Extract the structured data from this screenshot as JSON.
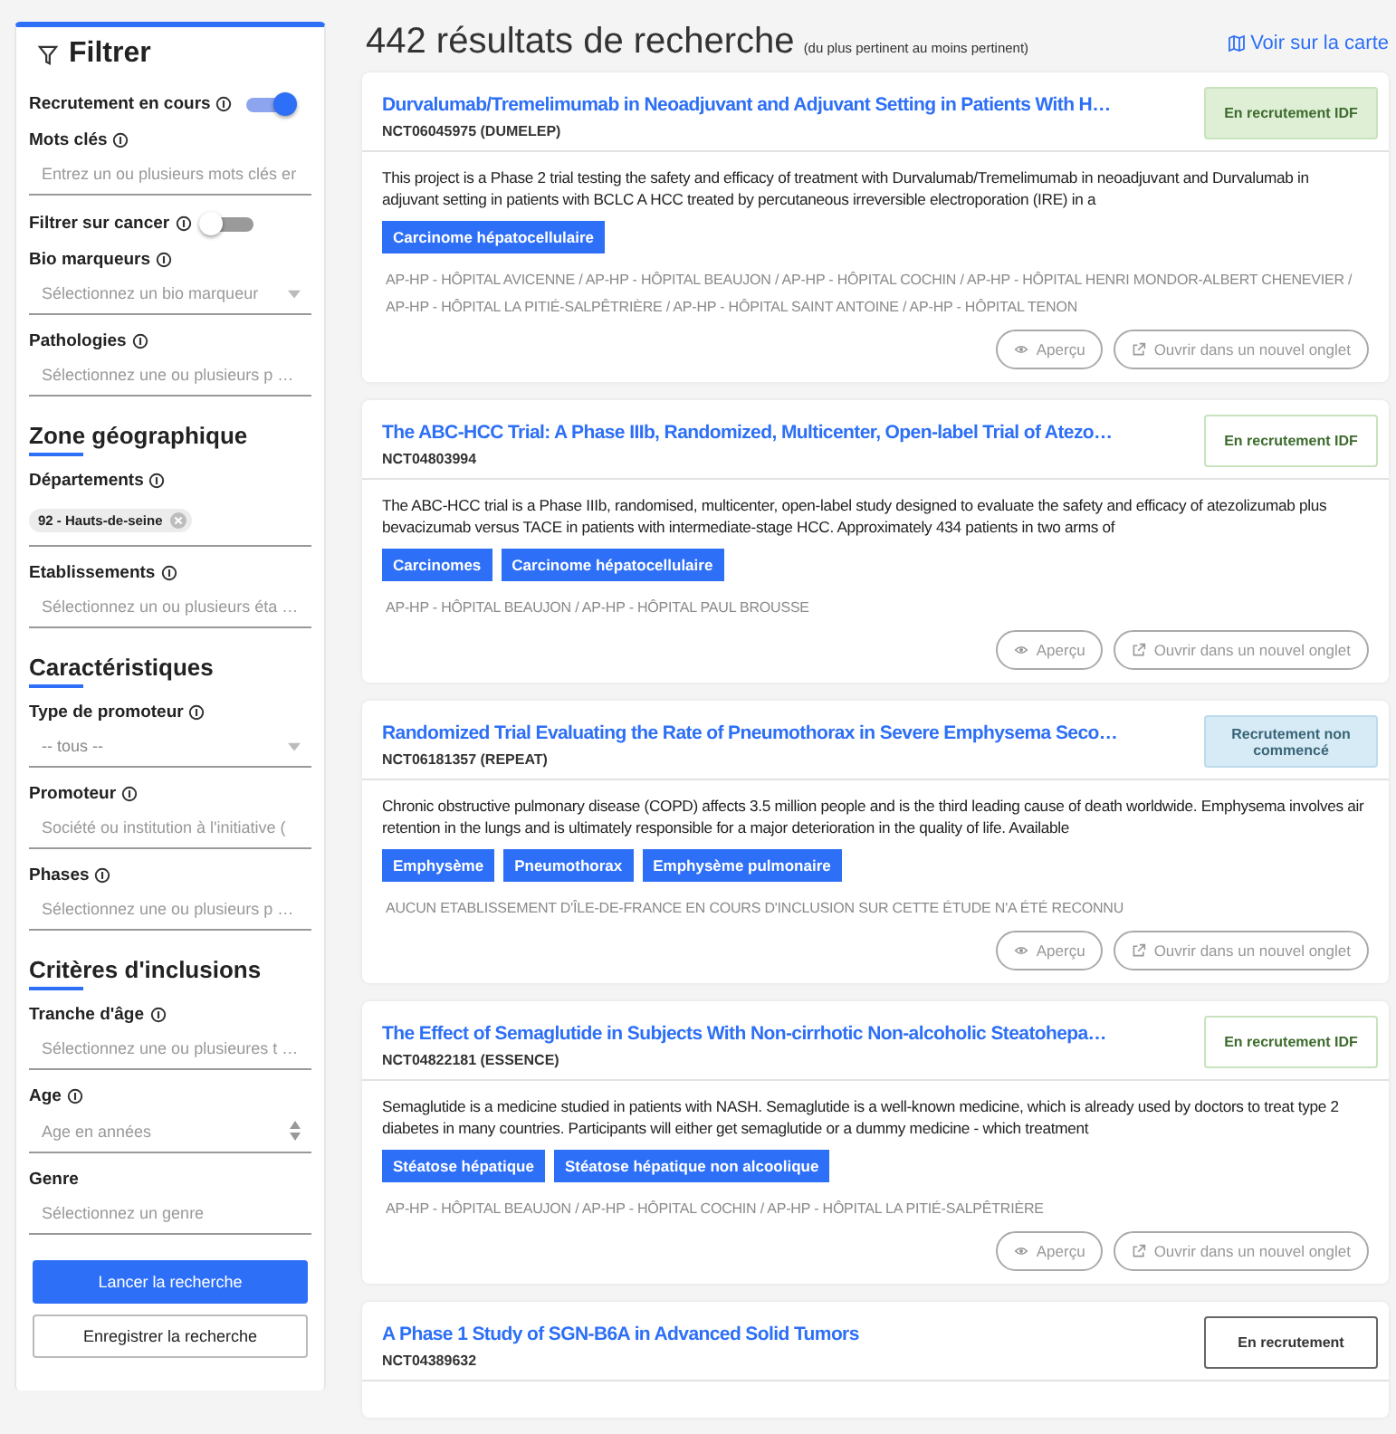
{
  "sidebar": {
    "title": "Filtrer",
    "items": [
      {
        "kind": "toggle",
        "label": "Recrutement en cours",
        "info": true,
        "on": true
      },
      {
        "kind": "text",
        "label": "Mots clés",
        "info": true,
        "placeholder": "Entrez un ou plusieurs mots clés er"
      },
      {
        "kind": "toggle",
        "label": "Filtrer sur cancer",
        "info": true,
        "on": false
      },
      {
        "kind": "select",
        "label": "Bio marqueurs",
        "info": true,
        "placeholder": "Sélectionnez un bio marqueur"
      },
      {
        "kind": "text",
        "label": "Pathologies",
        "info": true,
        "placeholder": "Sélectionnez une ou plusieurs p …"
      },
      {
        "kind": "heading",
        "label": "Zone géographique"
      },
      {
        "kind": "chips",
        "label": "Départements",
        "info": true,
        "chips": [
          "92 - Hauts-de-seine"
        ]
      },
      {
        "kind": "text",
        "label": "Etablissements",
        "info": true,
        "placeholder": "Sélectionnez un ou plusieurs éta …"
      },
      {
        "kind": "heading",
        "label": "Caractéristiques"
      },
      {
        "kind": "select",
        "label": "Type de promoteur",
        "info": true,
        "value": "-- tous --"
      },
      {
        "kind": "text",
        "label": "Promoteur",
        "info": true,
        "placeholder": "Société ou institution à l'initiative ("
      },
      {
        "kind": "text",
        "label": "Phases",
        "info": true,
        "placeholder": "Sélectionnez une ou plusieurs p …"
      },
      {
        "kind": "heading",
        "label": "Critères d'inclusions"
      },
      {
        "kind": "text",
        "label": "Tranche d'âge",
        "info": true,
        "placeholder": "Sélectionnez une ou plusieures t …"
      },
      {
        "kind": "number",
        "label": "Age",
        "info": true,
        "placeholder": "Age en années"
      },
      {
        "kind": "text",
        "label": "Genre",
        "info": false,
        "placeholder": "Sélectionnez un genre"
      }
    ],
    "buttons": [
      {
        "label": "Lancer la recherche",
        "kind": "primary"
      },
      {
        "label": "Enregistrer la recherche",
        "kind": "secondary"
      }
    ]
  },
  "header": {
    "title": "442 résultats de recherche",
    "subtitle": "(du plus pertinent au moins pertinent)",
    "map_link": "Voir sur la carte"
  },
  "results": [
    {
      "title": "Durvalumab/Tremelimumab in Neoadjuvant and Adjuvant Setting in Patients With H…",
      "id": "NCT06045975 (DUMELEP)",
      "status": {
        "label": "En recrutement IDF",
        "kind": "idf_active"
      },
      "description": "This project is a Phase 2 trial testing the safety and efficacy of treatment with Durvalumab/Tremelimumab in neoadjuvant and Durvalumab in adjuvant setting in patients with BCLC A HCC treated by percutaneous irreversible electroporation (IRE) in a",
      "tags": [
        "Carcinome hépatocellulaire"
      ],
      "sites": "AP-HP - HÔPITAL AVICENNE / AP-HP - HÔPITAL BEAUJON / AP-HP - HÔPITAL COCHIN / AP-HP - HÔPITAL HENRI MONDOR-ALBERT CHENEVIER / AP-HP - HÔPITAL LA PITIÉ-SALPÊTRIÈRE / AP-HP - HÔPITAL SAINT ANTOINE / AP-HP - HÔPITAL TENON",
      "actions": [
        {
          "label": "Aperçu",
          "kind": "preview"
        },
        {
          "label": "Ouvrir dans un nouvel onglet",
          "kind": "open"
        }
      ]
    },
    {
      "title": "The ABC-HCC Trial: A Phase IIIb, Randomized, Multicenter, Open-label Trial of Atezo…",
      "id": "NCT04803994",
      "status": {
        "label": "En recrutement IDF",
        "kind": "idf"
      },
      "description": "The ABC-HCC trial is a Phase IIIb, randomised, multicenter, open-label study designed to evaluate the safety and efficacy of atezolizumab plus bevacizumab versus TACE in patients with intermediate-stage HCC. Approximately 434 patients in two arms of",
      "tags": [
        "Carcinomes",
        "Carcinome hépatocellulaire"
      ],
      "sites": "AP-HP - HÔPITAL BEAUJON / AP-HP - HÔPITAL PAUL BROUSSE",
      "actions": [
        {
          "label": "Aperçu",
          "kind": "preview"
        },
        {
          "label": "Ouvrir dans un nouvel onglet",
          "kind": "open"
        }
      ]
    },
    {
      "title": "Randomized Trial Evaluating the Rate of Pneumothorax in Severe Emphysema Seco…",
      "id": "NCT06181357 (REPEAT)",
      "status": {
        "label": "Recrutement non commencé",
        "kind": "not_started"
      },
      "description": "Chronic obstructive pulmonary disease (COPD) affects 3.5 million people and is the third leading cause of death worldwide. Emphysema involves air retention in the lungs and is ultimately responsible for a major deterioration in the quality of life. Available",
      "tags": [
        "Emphysème",
        "Pneumothorax",
        "Emphysème pulmonaire"
      ],
      "sites": "AUCUN ETABLISSEMENT D'ÎLE-DE-FRANCE EN COURS D'INCLUSION SUR CETTE ÉTUDE N'A ÉTÉ RECONNU",
      "actions": [
        {
          "label": "Aperçu",
          "kind": "preview"
        },
        {
          "label": "Ouvrir dans un nouvel onglet",
          "kind": "open"
        }
      ]
    },
    {
      "title": "The Effect of Semaglutide in Subjects With Non-cirrhotic Non-alcoholic Steatohepa…",
      "id": "NCT04822181 (ESSENCE)",
      "status": {
        "label": "En recrutement IDF",
        "kind": "idf"
      },
      "description": "Semaglutide is a medicine studied in patients with NASH. Semaglutide is a well-known medicine, which is already used by doctors to treat type 2 diabetes in many countries. Participants will either get semaglutide or a dummy medicine - which treatment",
      "tags": [
        "Stéatose hépatique",
        "Stéatose hépatique non alcoolique"
      ],
      "sites": "AP-HP - HÔPITAL BEAUJON / AP-HP - HÔPITAL COCHIN / AP-HP - HÔPITAL LA PITIÉ-SALPÊTRIÈRE",
      "actions": [
        {
          "label": "Aperçu",
          "kind": "preview"
        },
        {
          "label": "Ouvrir dans un nouvel onglet",
          "kind": "open"
        }
      ]
    },
    {
      "title": "A Phase 1 Study of SGN-B6A in Advanced Solid Tumors",
      "id": "NCT04389632",
      "status": {
        "label": "En recrutement",
        "kind": "open"
      }
    }
  ]
}
